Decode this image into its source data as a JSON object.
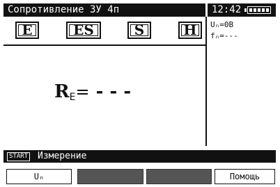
{
  "title": "Сопротивление 3У 4п",
  "clock": "12:42",
  "modes": [
    "E",
    "ES",
    "S",
    "H"
  ],
  "info": {
    "voltage": "Uₙ=0В",
    "frequency": "fₙ=---"
  },
  "result": {
    "symbol": "R",
    "subscript": "E",
    "equals": "=",
    "value": "- - -"
  },
  "status": {
    "start_key": "START",
    "message": "Измерение"
  },
  "softkeys": [
    "Uₙ",
    "",
    "",
    "Помощь"
  ],
  "colors": {
    "background": "#ffffff",
    "bar": "#111111",
    "disabled_key": "#555555"
  },
  "battery_level": 1.0
}
